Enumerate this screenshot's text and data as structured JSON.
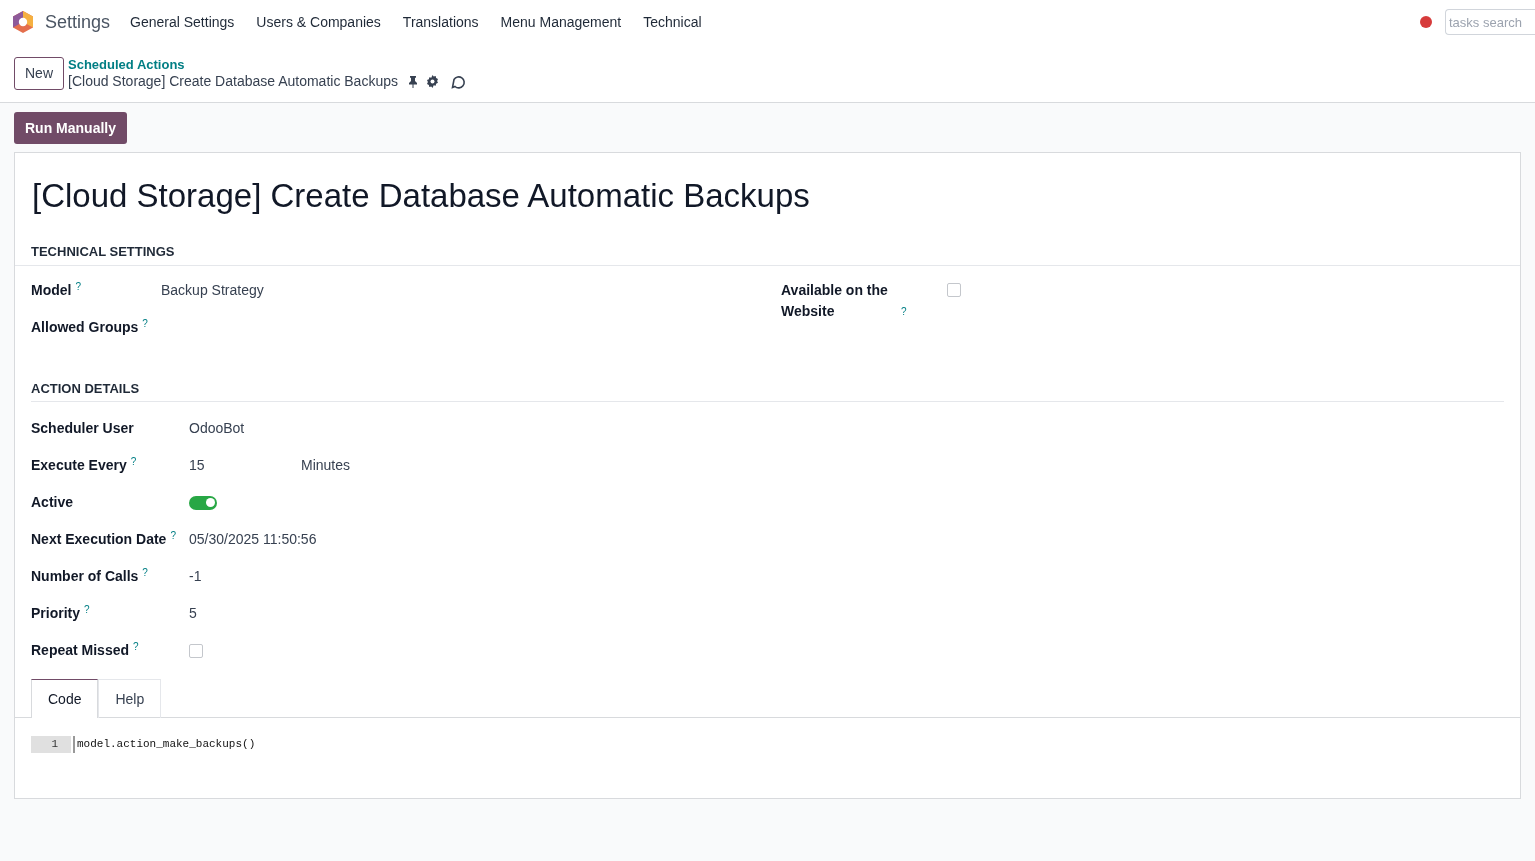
{
  "navbar": {
    "app_name": "Settings",
    "menu": [
      "General Settings",
      "Users & Companies",
      "Translations",
      "Menu Management",
      "Technical"
    ],
    "search": {
      "placeholder": "tasks search"
    }
  },
  "control_panel": {
    "new_button": "New",
    "breadcrumb": "Scheduled Actions",
    "record_title": "[Cloud Storage] Create Database Automatic Backups"
  },
  "action_button": "Run Manually",
  "form": {
    "title": "[Cloud Storage] Create Database Automatic Backups",
    "technical_settings": {
      "heading": "TECHNICAL SETTINGS",
      "left": [
        {
          "kind": "text",
          "label": "Model",
          "help": "?",
          "value": "Backup Strategy"
        },
        {
          "kind": "text",
          "label": "Allowed Groups",
          "help": "?"
        }
      ],
      "right": [
        {
          "kind": "checkbox",
          "label": "Available on the Website",
          "help": "?",
          "checked": false
        }
      ]
    },
    "action_details": {
      "heading": "ACTION DETAILS",
      "fields": [
        {
          "kind": "text",
          "label": "Scheduler User",
          "value": "OdooBot"
        },
        {
          "kind": "interval",
          "label": "Execute Every",
          "help": "?",
          "value": "15",
          "unit": "Minutes"
        },
        {
          "kind": "toggle",
          "label": "Active",
          "on": true
        },
        {
          "kind": "text",
          "label": "Next Execution Date",
          "help": "?",
          "value": "05/30/2025 11:50:56"
        },
        {
          "kind": "text",
          "label": "Number of Calls",
          "help": "?",
          "value": "-1"
        },
        {
          "kind": "text",
          "label": "Priority",
          "help": "?",
          "value": "5"
        },
        {
          "kind": "checkbox",
          "label": "Repeat Missed",
          "help": "?",
          "checked": false
        }
      ]
    },
    "tabs": [
      {
        "label": "Code",
        "selected": true
      },
      {
        "label": "Help",
        "selected": false
      }
    ],
    "code": [
      {
        "line_number": "1",
        "text": "model.action_make_backups()"
      }
    ]
  }
}
